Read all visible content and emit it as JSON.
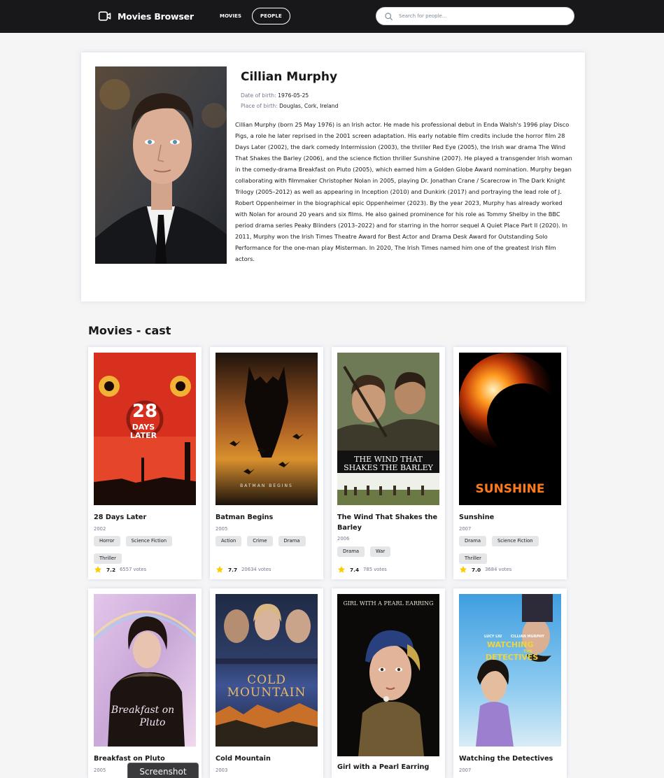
{
  "header": {
    "brand": "Movies Browser",
    "nav": {
      "movies": "MOVIES",
      "people": "PEOPLE"
    },
    "search_placeholder": "Search for people..."
  },
  "person": {
    "name": "Cillian Murphy",
    "dob_label": "Date of birth:",
    "dob": "1976-05-25",
    "pob_label": "Place of birth:",
    "pob": "Douglas, Cork, Ireland",
    "bio": "Cillian Murphy (born 25 May 1976) is an Irish actor. He made his professional debut in Enda Walsh's 1996 play Disco Pigs, a role he later reprised in the 2001 screen adaptation. His early notable film credits include the horror film 28 Days Later (2002), the dark comedy Intermission (2003), the thriller Red Eye (2005), the Irish war drama The Wind That Shakes the Barley (2006), and the science fiction thriller Sunshine (2007). He played a transgender Irish woman in the comedy-drama Breakfast on Pluto (2005), which earned him a Golden Globe Award nomination. Murphy began collaborating with filmmaker Christopher Nolan in 2005, playing Dr. Jonathan Crane / Scarecrow in The Dark Knight Trilogy (2005–2012) as well as appearing in Inception (2010) and Dunkirk (2017) and portraying the lead role of J. Robert Oppenheimer in the biographical epic Oppenheimer (2023). By the year 2023, Murphy has already worked with Nolan for around 20 years and six films. He also gained prominence for his role as Tommy Shelby in the BBC period drama series Peaky Blinders (2013–2022) and for starring in the horror sequel A Quiet Place Part II (2020). In 2011, Murphy won the Irish Times Theatre Award for Best Actor and Drama Desk Award for Outstanding Solo Performance for the one-man play Misterman. In 2020, The Irish Times named him one of the greatest Irish film actors."
  },
  "section_title": "Movies - cast",
  "movies": [
    {
      "title": "28 Days Later",
      "year": "2002",
      "genres": [
        "Horror",
        "Science Fiction",
        "Thriller"
      ],
      "rating": "7.2",
      "votes": "6557 votes",
      "poster_text": [
        "28",
        "DAYS",
        "LATER"
      ]
    },
    {
      "title": "Batman Begins",
      "year": "2005",
      "genres": [
        "Action",
        "Crime",
        "Drama"
      ],
      "rating": "7.7",
      "votes": "20634 votes",
      "poster_text": [
        "BATMAN BEGINS"
      ]
    },
    {
      "title": "The Wind That Shakes the Barley",
      "year": "2006",
      "genres": [
        "Drama",
        "War"
      ],
      "rating": "7.4",
      "votes": "785 votes",
      "poster_text": [
        "THE WIND THAT",
        "SHAKES THE BARLEY"
      ]
    },
    {
      "title": "Sunshine",
      "year": "2007",
      "genres": [
        "Drama",
        "Science Fiction",
        "Thriller"
      ],
      "rating": "7.0",
      "votes": "3684 votes",
      "poster_text": [
        "SUNSHINE"
      ]
    },
    {
      "title": "Breakfast on Pluto",
      "year": "2005",
      "genres": [],
      "rating": "",
      "votes": "",
      "poster_text": [
        "Breakfast on",
        "Pluto"
      ]
    },
    {
      "title": "Cold Mountain",
      "year": "2003",
      "genres": [],
      "rating": "",
      "votes": "",
      "poster_text": [
        "COLD",
        "MOUNTAIN"
      ]
    },
    {
      "title": "Girl with a Pearl Earring",
      "year": "",
      "genres": [],
      "rating": "",
      "votes": "",
      "poster_text": [
        "GIRL WITH A PEARL EARRING"
      ]
    },
    {
      "title": "Watching the Detectives",
      "year": "2007",
      "genres": [],
      "rating": "",
      "votes": "",
      "poster_text": [
        "LUCY LIU",
        "CILLIAN MURPHY",
        "WATCHING",
        "THE",
        "DETECTIVES"
      ]
    }
  ],
  "overlay": {
    "screenshot_label": "Screenshot"
  },
  "colors": {
    "header_bg": "#18181b",
    "star": "#fccb00",
    "genre_bg": "#e4e6e8",
    "muted": "#74788d"
  }
}
